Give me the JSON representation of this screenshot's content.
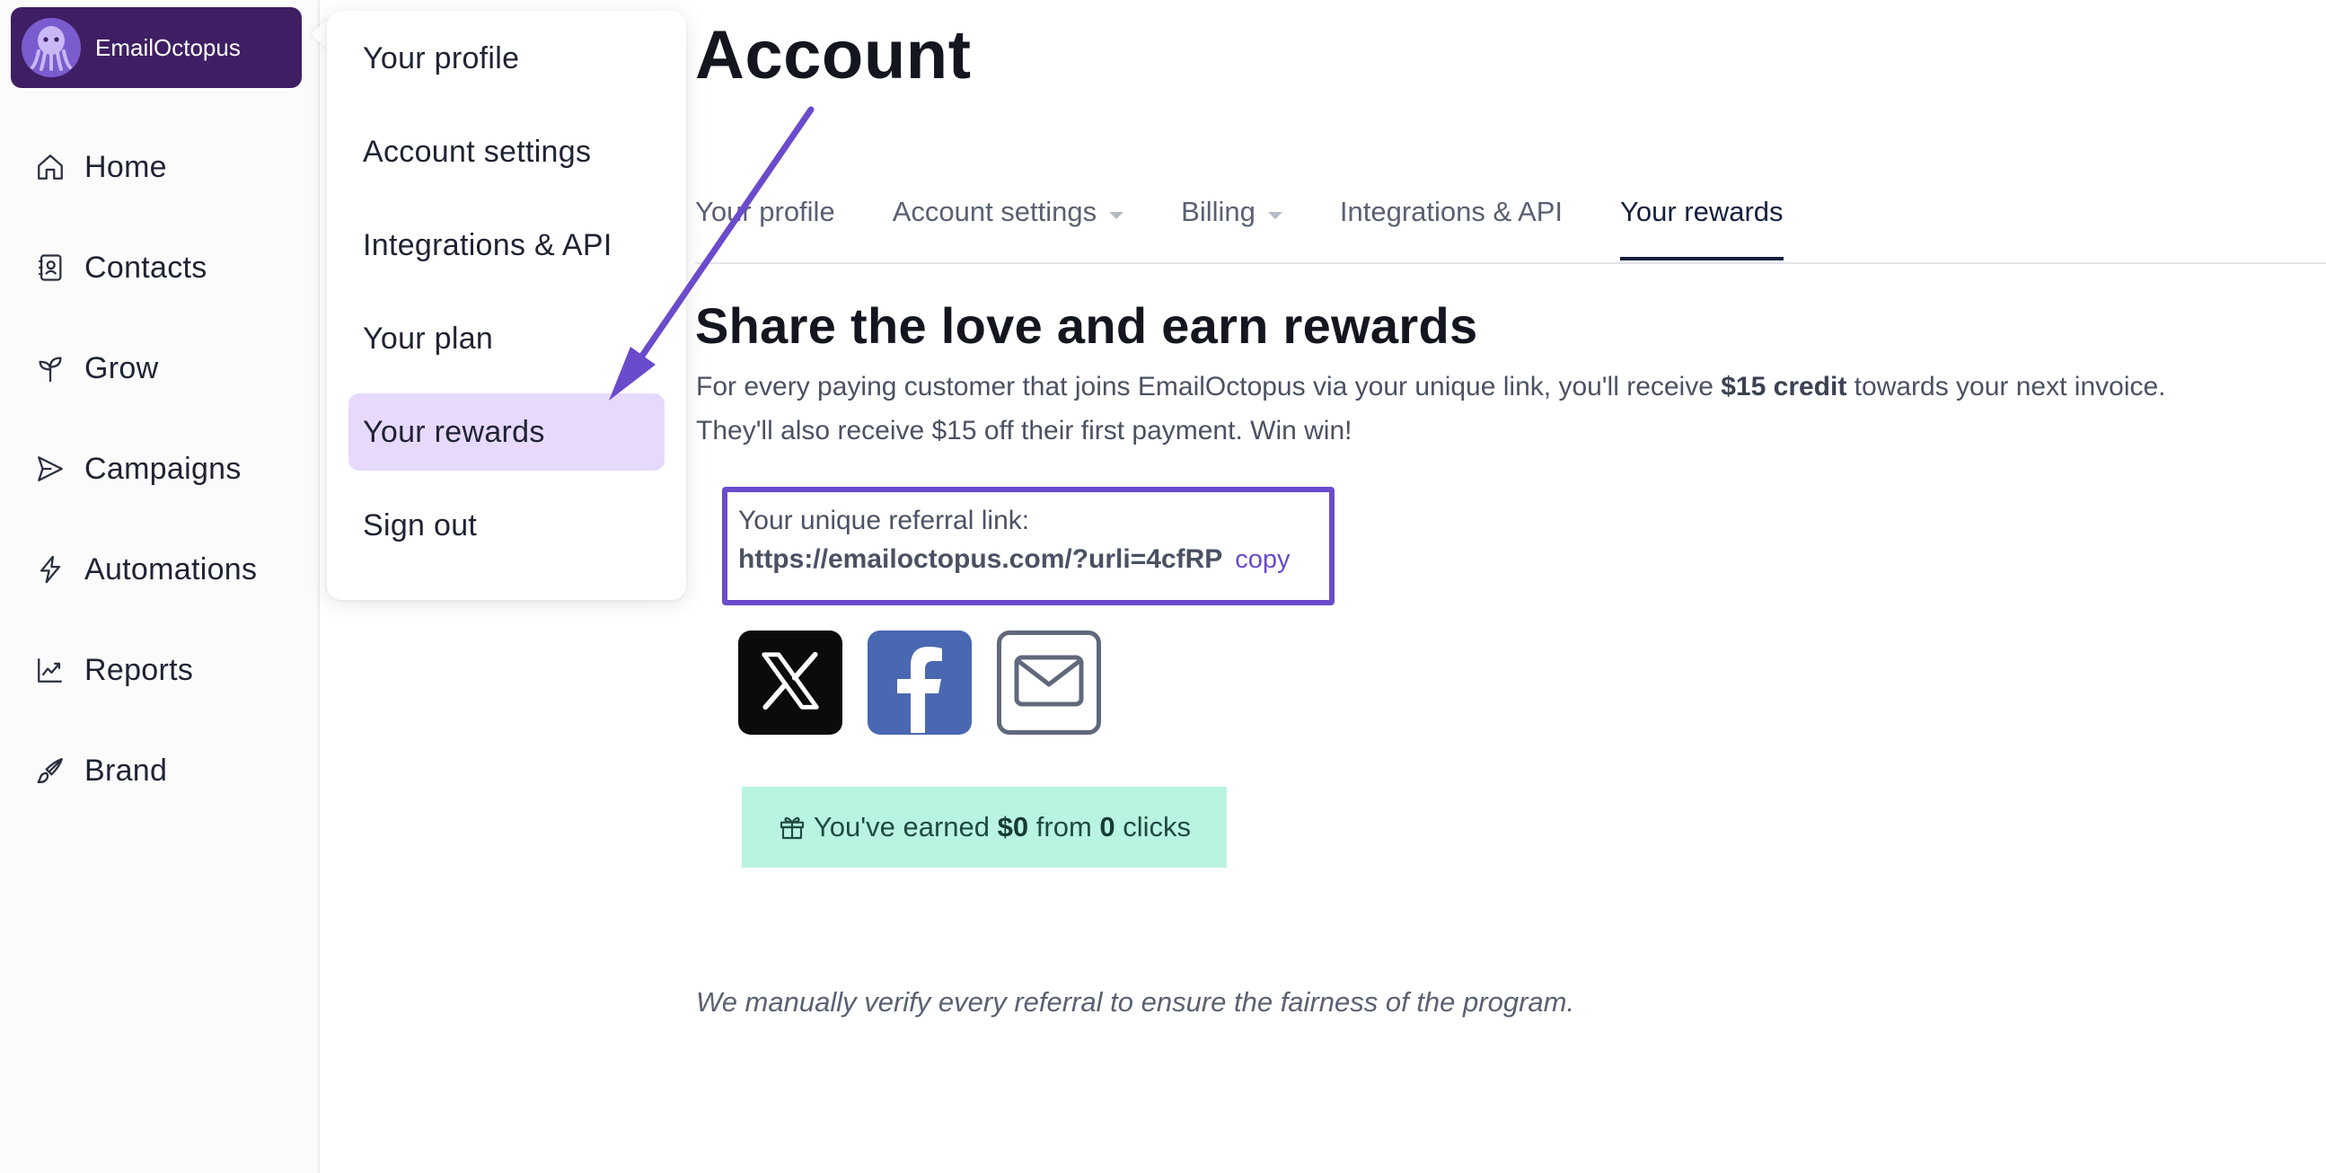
{
  "sidebar": {
    "brand": "EmailOctopus",
    "items": [
      {
        "label": "Home",
        "icon": "home-icon"
      },
      {
        "label": "Contacts",
        "icon": "contacts-icon"
      },
      {
        "label": "Grow",
        "icon": "sprout-icon"
      },
      {
        "label": "Campaigns",
        "icon": "send-icon"
      },
      {
        "label": "Automations",
        "icon": "lightning-icon"
      },
      {
        "label": "Reports",
        "icon": "chart-icon"
      },
      {
        "label": "Brand",
        "icon": "brush-icon"
      }
    ]
  },
  "menu": {
    "items": [
      {
        "label": "Your profile"
      },
      {
        "label": "Account settings"
      },
      {
        "label": "Integrations & API"
      },
      {
        "label": "Your plan"
      },
      {
        "label": "Your rewards",
        "active": true
      },
      {
        "label": "Sign out"
      }
    ]
  },
  "page": {
    "title": "Account",
    "tabs": [
      {
        "label": "Your profile"
      },
      {
        "label": "Account settings",
        "dropdown": true
      },
      {
        "label": "Billing",
        "dropdown": true
      },
      {
        "label": "Integrations & API"
      },
      {
        "label": "Your rewards",
        "active": true
      }
    ]
  },
  "rewards": {
    "title": "Share the love and earn rewards",
    "intro_1a": "For every paying customer that joins EmailOctopus via your unique link, you'll receive ",
    "intro_1b": "$15 credit",
    "intro_1c": " towards your next invoice.",
    "intro_2": "They'll also receive $15 off their first payment. Win win!",
    "referral_label": "Your unique referral link:",
    "referral_link": "https://emailoctopus.com/?urli=4cfRP",
    "copy_label": "copy",
    "share": [
      "x-icon",
      "facebook-icon",
      "email-icon"
    ],
    "earned_prefix": "You've earned ",
    "earned_amount": "$0",
    "earned_mid": " from ",
    "earned_clicks": "0",
    "earned_suffix": " clicks",
    "note": "We manually verify every referral to ensure the fairness of the program."
  },
  "colors": {
    "brand_dark": "#3f1f63",
    "accent": "#6a4bcc",
    "menu_active": "#e7d9fb",
    "earned_bg": "#b9f3e1"
  }
}
